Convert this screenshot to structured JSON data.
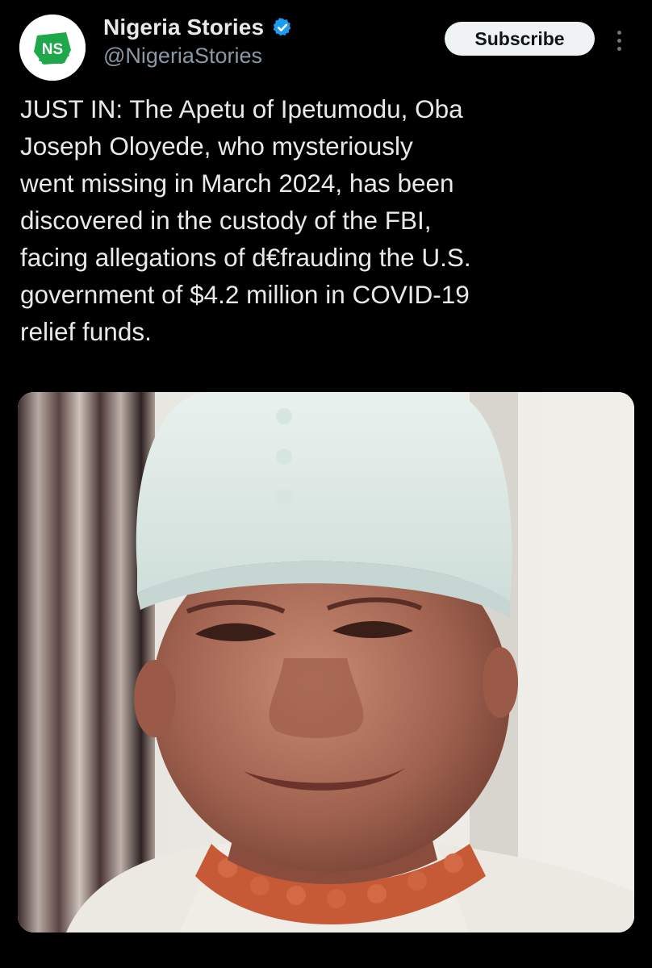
{
  "author": {
    "display_name": "Nigeria Stories",
    "handle": "@NigeriaStories",
    "avatar_initials": "NS",
    "verified": true
  },
  "actions": {
    "subscribe_label": "Subscribe",
    "more_icon": "more-dots-icon"
  },
  "tweet": {
    "text": "JUST IN: The Apetu of Ipetumodu, Oba\nJoseph Oloyede, who mysteriously\nwent missing in March 2024, has been\ndiscovered in the custody of the FBI,\nfacing allegations of d€frauding the U.S.\ngovernment of $4.2 million in COVID-19\nrelief funds."
  },
  "colors": {
    "background": "#000000",
    "text": "#e7e9ea",
    "secondary_text": "#8b98a5",
    "verified_blue": "#1d9bf0",
    "brand_green": "#1fa84a"
  }
}
